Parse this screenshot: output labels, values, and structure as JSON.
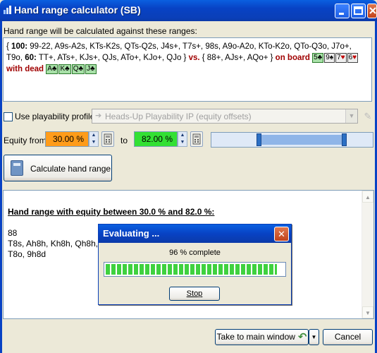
{
  "window": {
    "title": "Hand range calculator (SB)"
  },
  "description_label": "Hand range will be calculated against these ranges:",
  "ranges": {
    "line1_prefix": "{ ",
    "w100": "100:",
    "r100": " 99-22, A9s-A2s, KTs-K2s, QTs-Q2s, J4s+, T7s+, 98s, A9o-A2o, KTo-K2o, QTo-Q3o, J7o+, T9o, ",
    "w60": "60:",
    "r60": " TT+, ATs+, KJs+, QJs, ATo+, KJo+, QJo } ",
    "vs": "vs.",
    "opp": " { 88+, AJs+, AQo+ } ",
    "on_board": "on board",
    "board": [
      {
        "rank": "5",
        "suit": "♣",
        "red": false,
        "white": false
      },
      {
        "rank": "9",
        "suit": "♠",
        "red": false,
        "white": true
      },
      {
        "rank": "7",
        "suit": "♥",
        "red": true,
        "white": true
      },
      {
        "rank": "6",
        "suit": "♥",
        "red": true,
        "white": true
      }
    ],
    "with_dead": "with dead",
    "dead": [
      {
        "rank": "A",
        "suit": "♣",
        "red": false,
        "white": false
      },
      {
        "rank": "K",
        "suit": "♣",
        "red": false,
        "white": false
      },
      {
        "rank": "Q",
        "suit": "♣",
        "red": false,
        "white": false
      },
      {
        "rank": "J",
        "suit": "♣",
        "red": false,
        "white": false
      }
    ]
  },
  "playability": {
    "checkbox_label": "Use playability profile:",
    "checked": false,
    "profile_value": "Heads-Up Playability IP  (equity offsets)"
  },
  "equity": {
    "from_label": "Equity from",
    "from_value": "30.00 %",
    "to_label": "to",
    "to_value": "82.00 %",
    "from_color": "#ff9c1a",
    "to_color": "#33e033"
  },
  "calculate_button": "Calculate hand range",
  "results": {
    "heading": "Hand range with equity between 30.0 % and 82.0 %:",
    "lines": [
      "88",
      "T8s, Ah8h, Kh8h, Qh8h,",
      "T8o, 9h8d"
    ]
  },
  "evaluating_dialog": {
    "title": "Evaluating ...",
    "progress_text": "96 % complete",
    "progress_fraction": 0.96,
    "stop_label": "Stop"
  },
  "footer": {
    "main_window_button": "Take to main window",
    "cancel_button": "Cancel"
  }
}
